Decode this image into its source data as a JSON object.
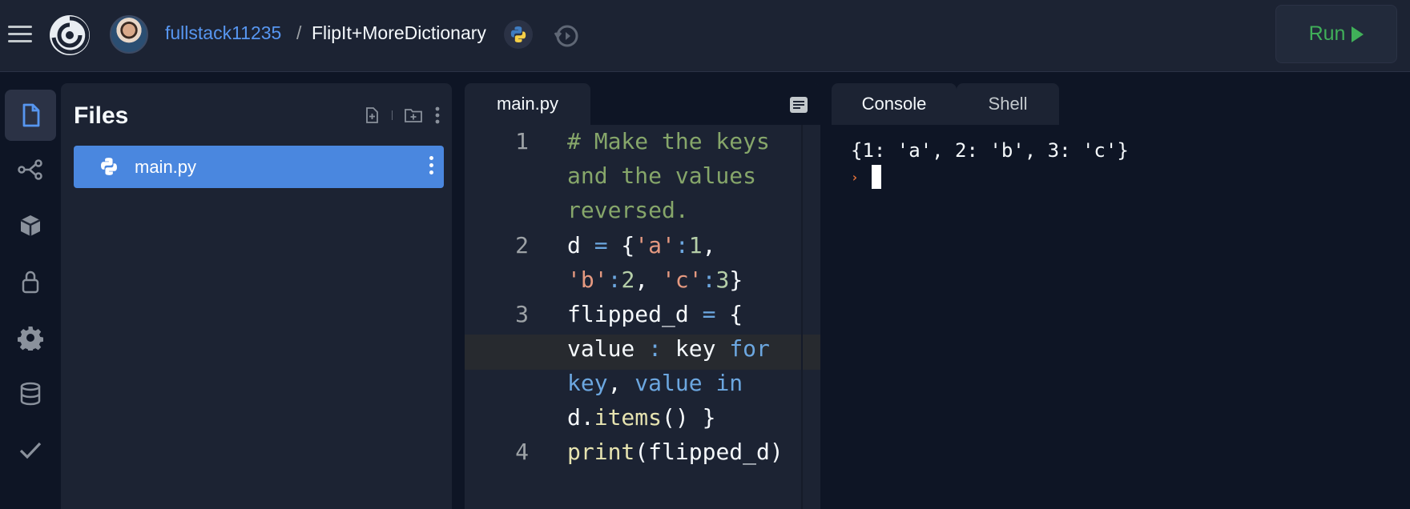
{
  "header": {
    "owner": "fullstack11235",
    "separator": "/",
    "repl_name": "FlipIt+MoreDictionary",
    "language_icon": "python-icon",
    "run_label": "Run"
  },
  "sidebar": {
    "items": [
      {
        "icon": "files-icon",
        "active": true
      },
      {
        "icon": "share-icon"
      },
      {
        "icon": "packages-icon"
      },
      {
        "icon": "secrets-lock-icon"
      },
      {
        "icon": "settings-gear-icon"
      },
      {
        "icon": "database-icon"
      },
      {
        "icon": "check-icon"
      }
    ]
  },
  "files": {
    "title": "Files",
    "items": [
      {
        "name": "main.py",
        "icon": "python-icon",
        "selected": true
      }
    ]
  },
  "editor": {
    "tab_label": "main.py",
    "lines": [
      {
        "number": "1",
        "wrapped": [
          "# Make the keys",
          "and the values",
          "reversed."
        ]
      },
      {
        "number": "2",
        "wrapped": [
          "d = {'a':1,",
          "'b':2, 'c':3}"
        ]
      },
      {
        "number": "3",
        "wrapped": [
          "flipped_d = {",
          "value : key for",
          "key, value in",
          "d.items() }"
        ]
      },
      {
        "number": "4",
        "wrapped": [
          "print(flipped_d)"
        ]
      }
    ]
  },
  "console": {
    "tabs": [
      {
        "label": "Console",
        "active": true
      },
      {
        "label": "Shell",
        "active": false
      }
    ],
    "output": "{1: 'a', 2: 'b', 3: 'c'}",
    "prompt_symbol": "›"
  },
  "colors": {
    "background": "#0e1525",
    "panel": "#1c2333",
    "accent_blue": "#4a87df",
    "run_green": "#40b059",
    "owner_link": "#5796f0"
  }
}
